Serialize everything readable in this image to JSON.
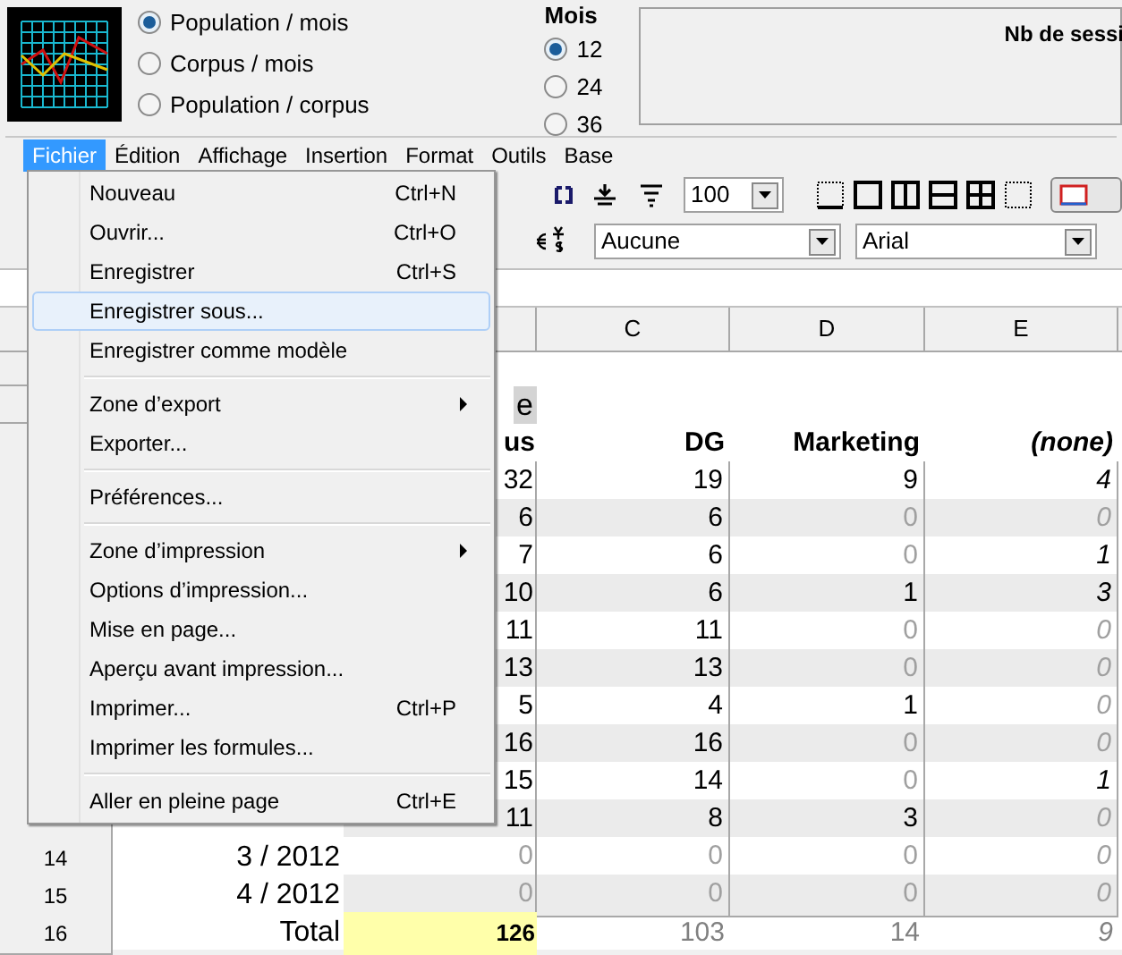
{
  "view_options": [
    {
      "label": "Population / mois",
      "selected": true
    },
    {
      "label": "Corpus / mois",
      "selected": false
    },
    {
      "label": "Population / corpus",
      "selected": false
    }
  ],
  "months": {
    "title": "Mois",
    "options": [
      {
        "label": "12",
        "selected": true
      },
      {
        "label": "24",
        "selected": false
      },
      {
        "label": "36",
        "selected": false
      }
    ]
  },
  "chart_panel": {
    "title": "Nb de sessi"
  },
  "menubar": [
    {
      "label": "Fichier",
      "selected": true
    },
    {
      "label": "Édition",
      "selected": false
    },
    {
      "label": "Affichage",
      "selected": false
    },
    {
      "label": "Insertion",
      "selected": false
    },
    {
      "label": "Format",
      "selected": false
    },
    {
      "label": "Outils",
      "selected": false
    },
    {
      "label": "Base",
      "selected": false
    }
  ],
  "toolbar": {
    "zoom": "100",
    "style": "Aucune",
    "font": "Arial"
  },
  "sheet": {
    "columns": [
      "C",
      "D",
      "E"
    ],
    "title_cell": "e",
    "headers": [
      "us",
      "DG",
      "Marketing",
      "(none)"
    ],
    "rows": [
      {
        "shaded": false,
        "cells": [
          {
            "text": "32",
            "muted": false
          },
          {
            "text": "19",
            "muted": false
          },
          {
            "text": "9",
            "muted": false
          },
          {
            "text": "4",
            "muted": false
          }
        ]
      },
      {
        "shaded": true,
        "cells": [
          {
            "text": "6",
            "muted": false
          },
          {
            "text": "6",
            "muted": false
          },
          {
            "text": "0",
            "muted": true
          },
          {
            "text": "0",
            "muted": true
          }
        ]
      },
      {
        "shaded": false,
        "cells": [
          {
            "text": "7",
            "muted": false
          },
          {
            "text": "6",
            "muted": false
          },
          {
            "text": "0",
            "muted": true
          },
          {
            "text": "1",
            "muted": false
          }
        ]
      },
      {
        "shaded": true,
        "cells": [
          {
            "text": "10",
            "muted": false
          },
          {
            "text": "6",
            "muted": false
          },
          {
            "text": "1",
            "muted": false
          },
          {
            "text": "3",
            "muted": false
          }
        ]
      },
      {
        "shaded": false,
        "cells": [
          {
            "text": "11",
            "muted": false
          },
          {
            "text": "11",
            "muted": false
          },
          {
            "text": "0",
            "muted": true
          },
          {
            "text": "0",
            "muted": true
          }
        ]
      },
      {
        "shaded": true,
        "cells": [
          {
            "text": "13",
            "muted": false
          },
          {
            "text": "13",
            "muted": false
          },
          {
            "text": "0",
            "muted": true
          },
          {
            "text": "0",
            "muted": true
          }
        ]
      },
      {
        "shaded": false,
        "cells": [
          {
            "text": "5",
            "muted": false
          },
          {
            "text": "4",
            "muted": false
          },
          {
            "text": "1",
            "muted": false
          },
          {
            "text": "0",
            "muted": true
          }
        ]
      },
      {
        "shaded": true,
        "cells": [
          {
            "text": "16",
            "muted": false
          },
          {
            "text": "16",
            "muted": false
          },
          {
            "text": "0",
            "muted": true
          },
          {
            "text": "0",
            "muted": true
          }
        ]
      },
      {
        "shaded": false,
        "cells": [
          {
            "text": "15",
            "muted": false
          },
          {
            "text": "14",
            "muted": false
          },
          {
            "text": "0",
            "muted": true
          },
          {
            "text": "1",
            "muted": false
          }
        ]
      },
      {
        "shaded": true,
        "cells": [
          {
            "text": "11",
            "muted": false
          },
          {
            "text": "8",
            "muted": false
          },
          {
            "text": "3",
            "muted": false
          },
          {
            "text": "0",
            "muted": true
          }
        ]
      },
      {
        "number": "14",
        "label": "3 / 2012",
        "shaded": false,
        "cells": [
          {
            "text": "0",
            "muted": true
          },
          {
            "text": "0",
            "muted": true
          },
          {
            "text": "0",
            "muted": true
          },
          {
            "text": "0",
            "muted": true
          }
        ]
      },
      {
        "number": "15",
        "label": "4 / 2012",
        "shaded": true,
        "cells": [
          {
            "text": "0",
            "muted": true
          },
          {
            "text": "0",
            "muted": true
          },
          {
            "text": "0",
            "muted": true
          },
          {
            "text": "0",
            "muted": true
          }
        ]
      },
      {
        "number": "16",
        "label": "Total",
        "kind": "total",
        "cells": [
          {
            "text": "126",
            "muted": false
          },
          {
            "text": "103",
            "muted": true
          },
          {
            "text": "14",
            "muted": true
          },
          {
            "text": "9",
            "muted": true
          }
        ]
      }
    ]
  },
  "file_menu": [
    {
      "kind": "item",
      "label": "Nouveau",
      "shortcut": "Ctrl+N",
      "selected": false
    },
    {
      "kind": "item",
      "label": "Ouvrir...",
      "shortcut": "Ctrl+O",
      "selected": false
    },
    {
      "kind": "item",
      "label": "Enregistrer",
      "shortcut": "Ctrl+S",
      "selected": false
    },
    {
      "kind": "item",
      "label": "Enregistrer sous...",
      "selected": true
    },
    {
      "kind": "item",
      "label": "Enregistrer comme modèle",
      "selected": false
    },
    {
      "kind": "separator"
    },
    {
      "kind": "item",
      "label": "Zone d’export",
      "submenu": true,
      "selected": false
    },
    {
      "kind": "item",
      "label": "Exporter...",
      "selected": false
    },
    {
      "kind": "separator"
    },
    {
      "kind": "item",
      "label": "Préférences...",
      "selected": false
    },
    {
      "kind": "separator"
    },
    {
      "kind": "item",
      "label": "Zone d’impression",
      "submenu": true,
      "selected": false
    },
    {
      "kind": "item",
      "label": "Options d’impression...",
      "selected": false
    },
    {
      "kind": "item",
      "label": "Mise en page...",
      "selected": false
    },
    {
      "kind": "item",
      "label": "Aperçu avant impression...",
      "selected": false
    },
    {
      "kind": "item",
      "label": "Imprimer...",
      "shortcut": "Ctrl+P",
      "selected": false
    },
    {
      "kind": "item",
      "label": "Imprimer les formules...",
      "selected": false
    },
    {
      "kind": "separator"
    },
    {
      "kind": "item",
      "label": "Aller en pleine page",
      "shortcut": "Ctrl+E",
      "selected": false
    }
  ]
}
